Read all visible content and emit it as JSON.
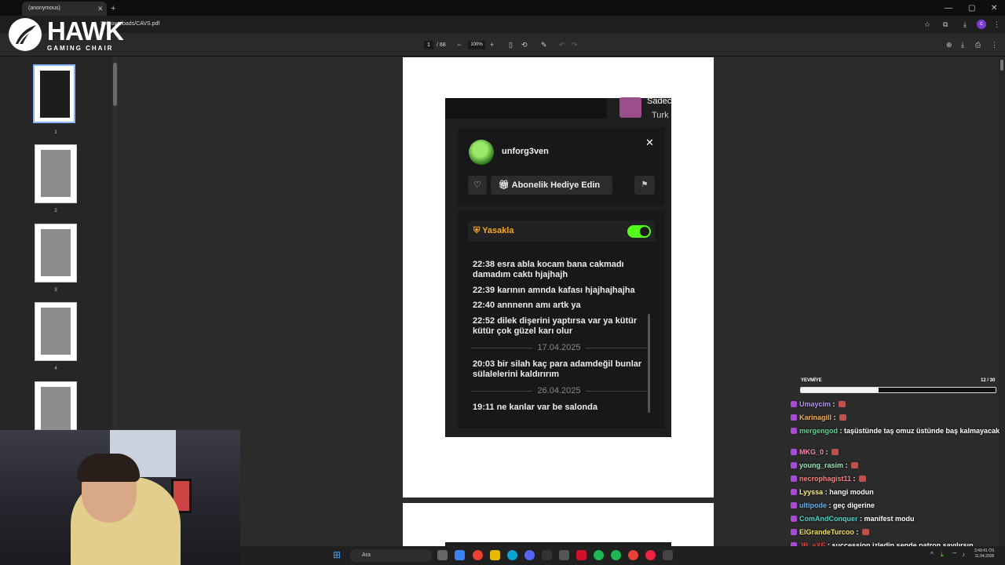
{
  "browser": {
    "tab_title": "(anonymous)",
    "url": "SI/Downloads/CAVS.pdf",
    "profile_initial": "c"
  },
  "pdf_toolbar": {
    "page_current": "1",
    "page_total": "/ 68",
    "zoom": "100%"
  },
  "thumbnails": [
    "1",
    "2",
    "3",
    "4"
  ],
  "overlay_logo": {
    "name": "HAWK",
    "subtitle": "GAMING CHAIR"
  },
  "screenshot": {
    "top_right_name": "Sadec",
    "top_right_sub": "Turk",
    "username": "unforg3ven",
    "gift_label": "Abonelik Hediye Edin",
    "ban_label": "Yasakla",
    "ban_enabled": true,
    "messages": [
      {
        "text": "22:38 esra abla kocam bana cakmadı damadım caktı hjajhajh"
      },
      {
        "text": "22:39 karının amnda kafası hjajhajhajha"
      },
      {
        "text": "22:40 annnenn amı artk ya"
      },
      {
        "text": "22:52 dilek dişerini yaptırsa var ya kütür kütür çok güzel karı olur"
      }
    ],
    "date_1": "17.04.2025",
    "messages_2": [
      {
        "text": "20:03 bir silah kaç para adamdeğil bunlar sülalelerini kaldırırım"
      }
    ],
    "date_2": "26.04.2025",
    "messages_3": [
      {
        "text": "19:11 ne kanlar var be salonda"
      }
    ]
  },
  "goal": {
    "title": "YEVMİYE",
    "count": "12 / 30",
    "progress": 0.4
  },
  "chat": [
    {
      "user": "Umaycim",
      "color": "#b794f4",
      "text": ""
    },
    {
      "user": "Karinagill",
      "color": "#f6ad55",
      "text": ""
    },
    {
      "user": "mergengod",
      "color": "#68d391",
      "text": "taşüstünde taş omuz üstünde baş kalmayacak"
    },
    {
      "user": "MKG_0",
      "color": "#f687b3",
      "text": ""
    },
    {
      "user": "young_rasim",
      "color": "#9ae6b4",
      "text": ""
    },
    {
      "user": "necrophagist11",
      "color": "#fc8181",
      "text": ""
    },
    {
      "user": "Lyyssa",
      "color": "#faf089",
      "text": "hangi modun"
    },
    {
      "user": "ultipode",
      "color": "#63b3ed",
      "text": "geç digerine"
    },
    {
      "user": "ComAndConquer",
      "color": "#4fd1c5",
      "text": "manifest modu"
    },
    {
      "user": "ElGrandeTurcoo",
      "color": "#f6e05e",
      "text": ""
    },
    {
      "user": "JB_eXE",
      "color": "#e53e3e",
      "text": "succession izledin sende patron sayılırsın dsflksdjfsdhfsd"
    }
  ],
  "taskbar": {
    "search_placeholder": "Ara",
    "time": "3:49:41 ÖS",
    "date": "11.04.2026"
  }
}
